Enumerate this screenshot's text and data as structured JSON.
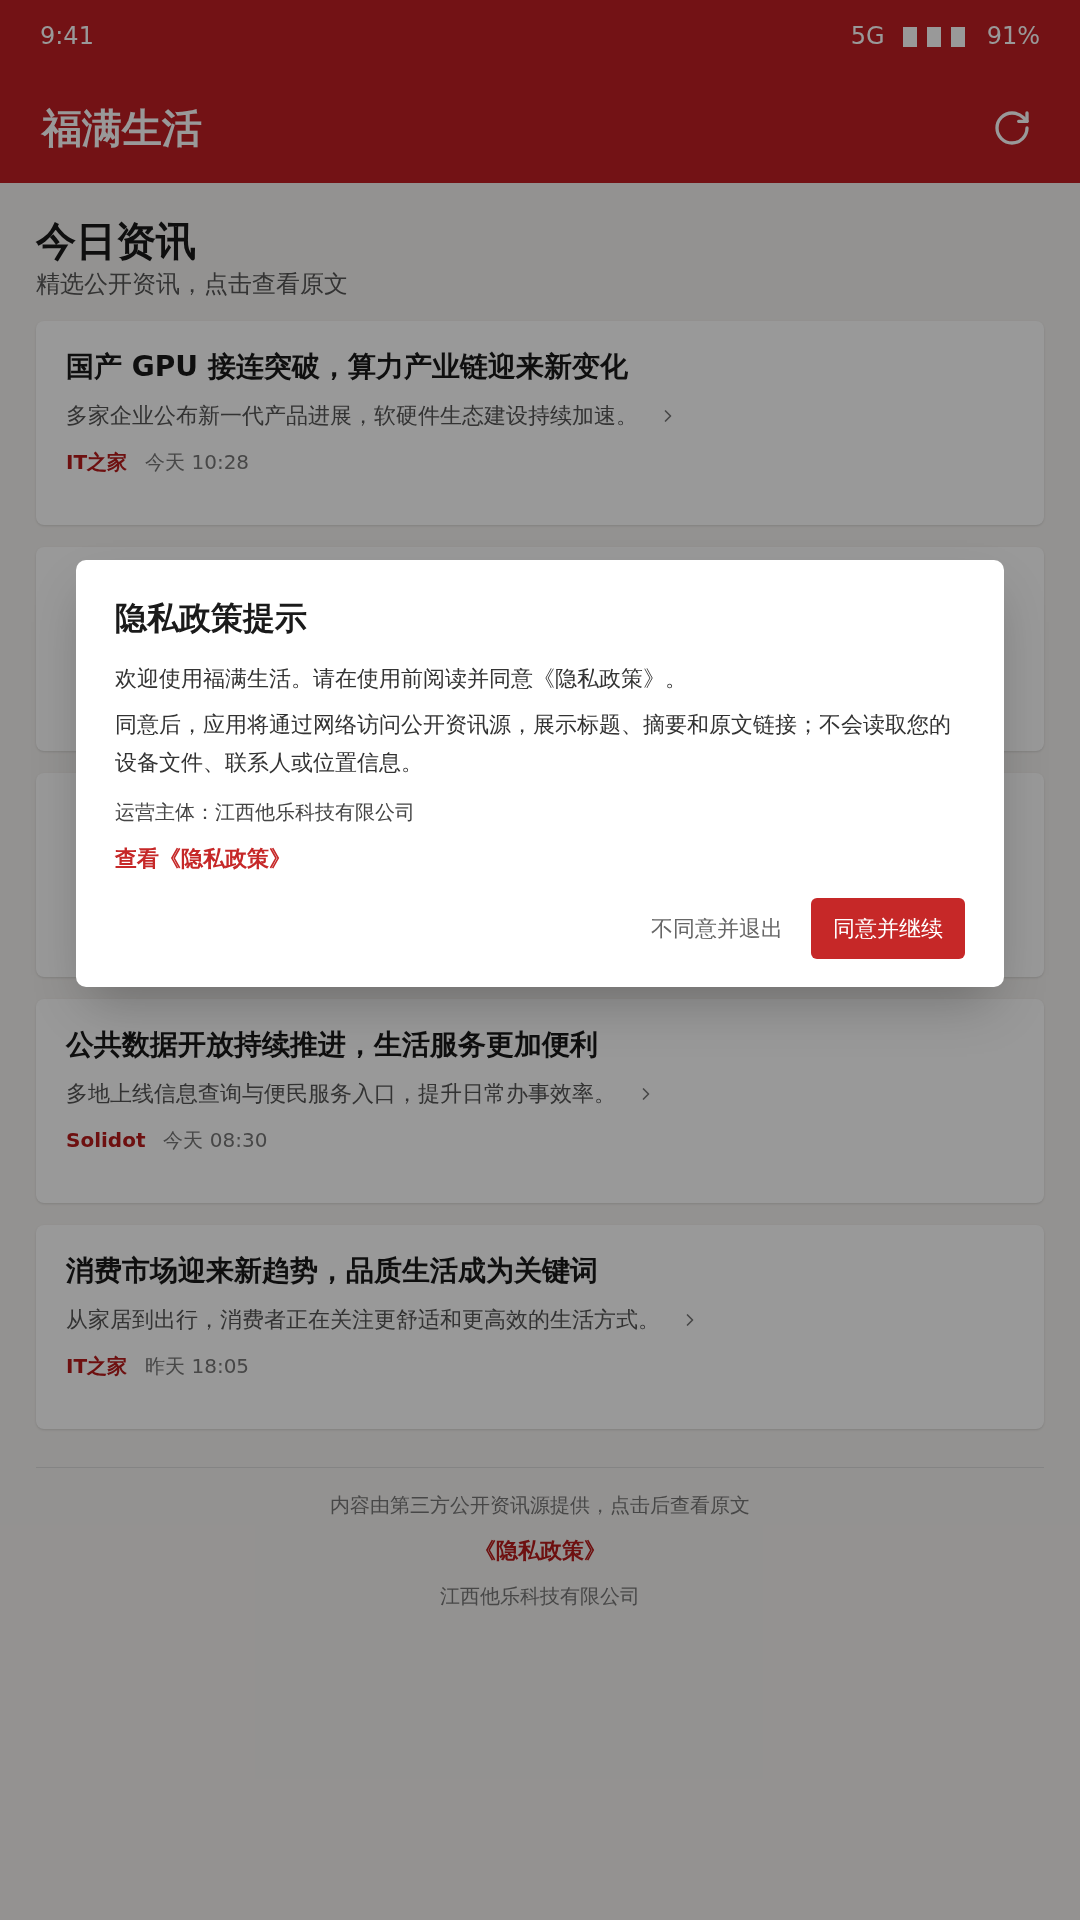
{
  "status_bar": {
    "time": "9:41",
    "network": "5G",
    "battery": "91%"
  },
  "app_bar": {
    "title": "福满生活"
  },
  "section": {
    "title": "今日资讯",
    "subtitle": "精选公开资讯，点击查看原文"
  },
  "articles": [
    {
      "kind": "visible",
      "title": "国产 GPU 接连突破，算力产业链迎来新变化",
      "summary": "多家企业公布新一代产品进展，软硬件生态建设持续加速。",
      "source": "IT之家",
      "time": "今天 10:28"
    },
    {
      "kind": "covered"
    },
    {
      "kind": "covered"
    },
    {
      "kind": "visible",
      "title": "公共数据开放持续推进，生活服务更加便利",
      "summary": "多地上线信息查询与便民服务入口，提升日常办事效率。",
      "source": "Solidot",
      "time": "今天 08:30"
    },
    {
      "kind": "visible",
      "title": "消费市场迎来新趋势，品质生活成为关键词",
      "summary": "从家居到出行，消费者正在关注更舒适和更高效的生活方式。",
      "source": "IT之家",
      "time": "昨天 18:05"
    }
  ],
  "footer": {
    "note": "内容由第三方公开资讯源提供，点击后查看原文",
    "policy_link": "《隐私政策》",
    "company": "江西他乐科技有限公司"
  },
  "dialog": {
    "open": true,
    "title": "隐私政策提示",
    "paragraphs": [
      "欢迎使用福满生活。请在使用前阅读并同意《隐私政策》。",
      "同意后，应用将通过网络访问公开资讯源，展示标题、摘要和原文链接；不会读取您的设备文件、联系人或位置信息。"
    ],
    "operator": "运营主体：江西他乐科技有限公司",
    "policy_link": "查看《隐私政策》",
    "decline_button": "不同意并退出",
    "accept_button": "同意并继续"
  }
}
